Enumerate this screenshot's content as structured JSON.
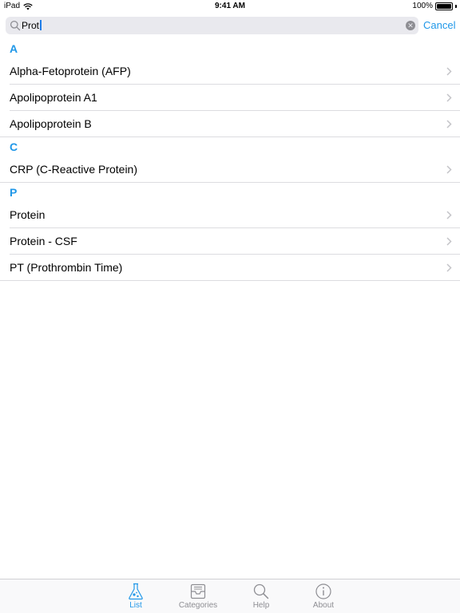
{
  "status_bar": {
    "device": "iPad",
    "time": "9:41 AM",
    "battery": "100%"
  },
  "search": {
    "value": "Prot",
    "placeholder": "",
    "cancel_label": "Cancel",
    "icon": "search-icon"
  },
  "sections": [
    {
      "header": "A",
      "items": [
        "Alpha-Fetoprotein (AFP)",
        "Apolipoprotein A1",
        "Apolipoprotein B"
      ]
    },
    {
      "header": "C",
      "items": [
        "CRP (C-Reactive Protein)"
      ]
    },
    {
      "header": "P",
      "items": [
        "Protein",
        "Protein - CSF",
        "PT (Prothrombin Time)"
      ]
    }
  ],
  "tabs": [
    {
      "label": "List",
      "icon": "flask-icon",
      "active": true
    },
    {
      "label": "Categories",
      "icon": "tray-icon",
      "active": false
    },
    {
      "label": "Help",
      "icon": "magnifier-icon",
      "active": false
    },
    {
      "label": "About",
      "icon": "info-icon",
      "active": false
    }
  ],
  "colors": {
    "accent": "#1f97e8",
    "inactive": "#8e8e93",
    "separator": "#dcdce0",
    "search_bg": "#e9e9ee"
  }
}
